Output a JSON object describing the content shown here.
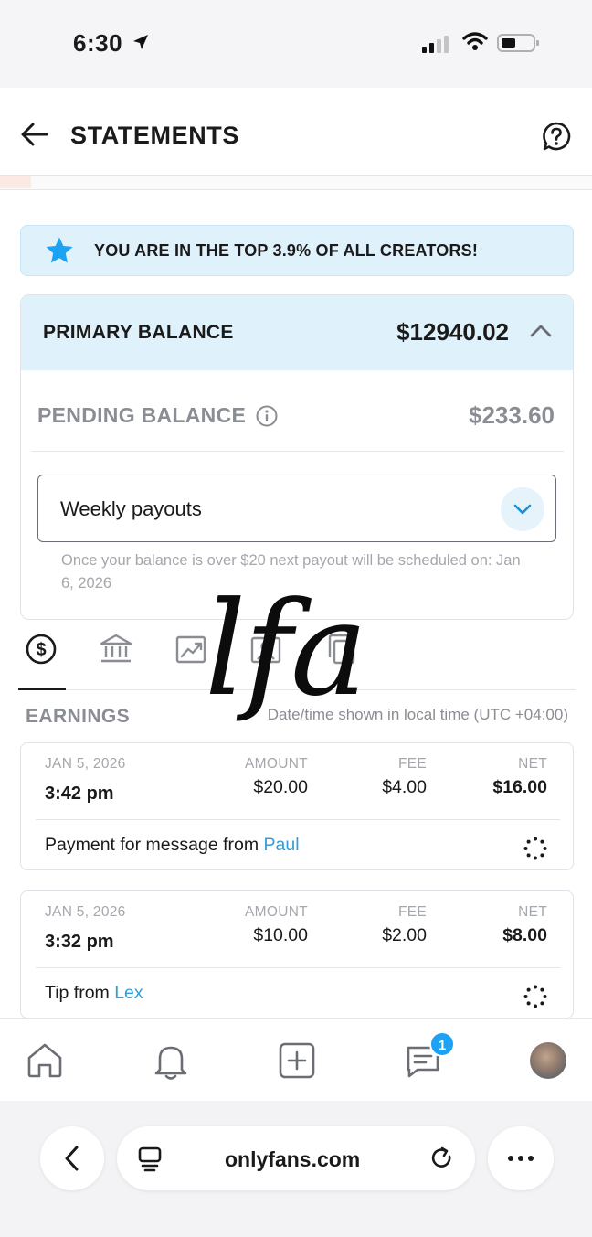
{
  "status_bar": {
    "time": "6:30"
  },
  "header": {
    "title": "STATEMENTS"
  },
  "banner": {
    "text": "YOU ARE IN THE TOP 3.9% OF ALL CREATORS!"
  },
  "balance": {
    "primary_label": "PRIMARY BALANCE",
    "primary_amount": "$12940.02",
    "pending_label": "PENDING BALANCE",
    "pending_amount": "$233.60",
    "payout_frequency": "Weekly payouts",
    "payout_note": "Once your balance is over $20 next payout will be scheduled on: Jan 6, 2026"
  },
  "tabs": [
    {
      "icon": "dollar-circle-icon",
      "active": true
    },
    {
      "icon": "bank-icon"
    },
    {
      "icon": "chart-trend-icon"
    },
    {
      "icon": "id-card-icon"
    },
    {
      "icon": "copy-icon"
    }
  ],
  "earnings": {
    "heading": "EARNINGS",
    "tz_note": "Date/time shown in local time (UTC +04:00)",
    "col_amount": "AMOUNT",
    "col_fee": "FEE",
    "col_net": "NET",
    "transactions": [
      {
        "date": "JAN 5, 2026",
        "time": "3:42 pm",
        "amount": "$20.00",
        "fee": "$4.00",
        "net": "$16.00",
        "desc": "Payment for message from ",
        "user": "Paul"
      },
      {
        "date": "JAN 5, 2026",
        "time": "3:32 pm",
        "amount": "$10.00",
        "fee": "$2.00",
        "net": "$8.00",
        "desc": "Tip from ",
        "user": "Lex"
      }
    ]
  },
  "bottom_nav": {
    "messages_badge": "1"
  },
  "browser": {
    "url": "onlyfans.com"
  },
  "watermark": "lfa",
  "colors": {
    "accent": "#1da1f2",
    "banner_bg": "#dff1fb",
    "link": "#2f9fd6"
  }
}
